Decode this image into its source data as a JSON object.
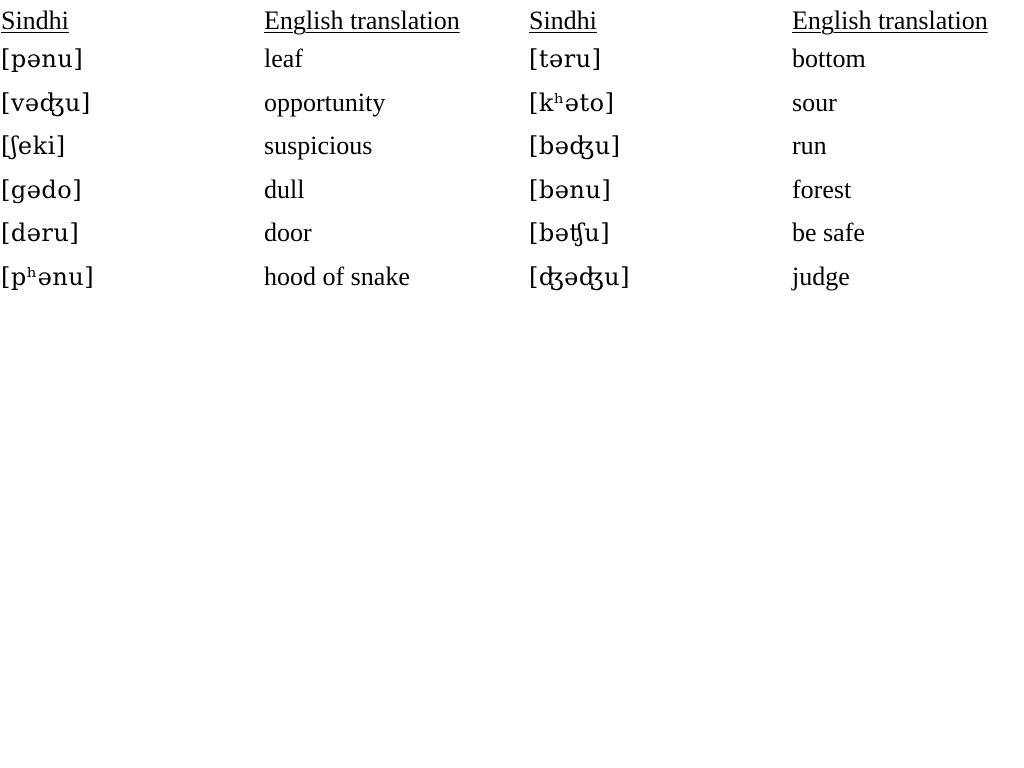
{
  "headers": [
    "Sindhi",
    "English translation",
    "Sindhi",
    "English translation"
  ],
  "left": [
    {
      "sindhi": "[pənu]",
      "english": "leaf"
    },
    {
      "sindhi": "[vəʤu]",
      "english": "opportunity"
    },
    {
      "sindhi": "[ʃeki]",
      "english": "suspicious"
    },
    {
      "sindhi": "[gədo]",
      "english": "dull"
    },
    {
      "sindhi": "[dəru]",
      "english": "door"
    },
    {
      "sindhi": "[pʰənu]",
      "english": "hood of snake"
    }
  ],
  "right": [
    {
      "sindhi": "[təru]",
      "english": "bottom"
    },
    {
      "sindhi": "[kʰəto]",
      "english": "sour"
    },
    {
      "sindhi": "[bəʤu]",
      "english": "run"
    },
    {
      "sindhi": "[bənu]",
      "english": "forest"
    },
    {
      "sindhi": "[bəʧu]",
      "english": "be safe"
    },
    {
      "sindhi": "[ʤəʤu]",
      "english": "judge"
    }
  ]
}
